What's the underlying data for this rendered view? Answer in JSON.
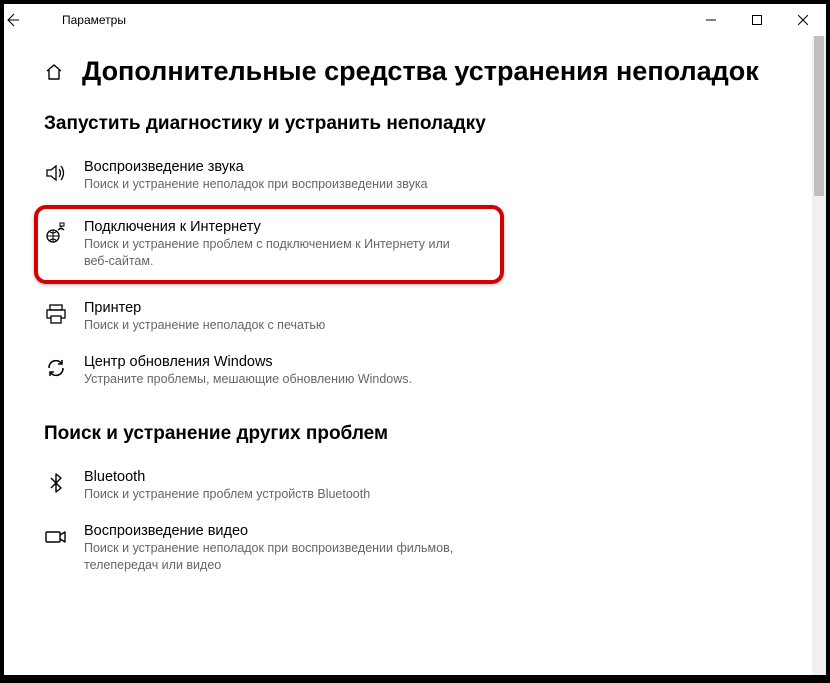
{
  "titlebar": {
    "app_name": "Параметры"
  },
  "page": {
    "heading": "Дополнительные средства устранения неполадок",
    "section1_title": "Запустить диагностику и устранить неполадку",
    "section2_title": "Поиск и устранение других проблем"
  },
  "items": {
    "sound": {
      "title": "Воспроизведение звука",
      "desc": "Поиск и устранение неполадок при воспроизведении звука"
    },
    "internet": {
      "title": "Подключения к Интернету",
      "desc": "Поиск и устранение проблем с подключением к Интернету или веб-сайтам."
    },
    "printer": {
      "title": "Принтер",
      "desc": "Поиск и устранение неполадок с печатью"
    },
    "update": {
      "title": "Центр обновления Windows",
      "desc": "Устраните проблемы, мешающие обновлению Windows."
    },
    "bluetooth": {
      "title": "Bluetooth",
      "desc": "Поиск и устранение проблем устройств Bluetooth"
    },
    "video": {
      "title": "Воспроизведение видео",
      "desc": "Поиск и устранение неполадок при воспроизведении фильмов, телепередач или видео"
    }
  }
}
